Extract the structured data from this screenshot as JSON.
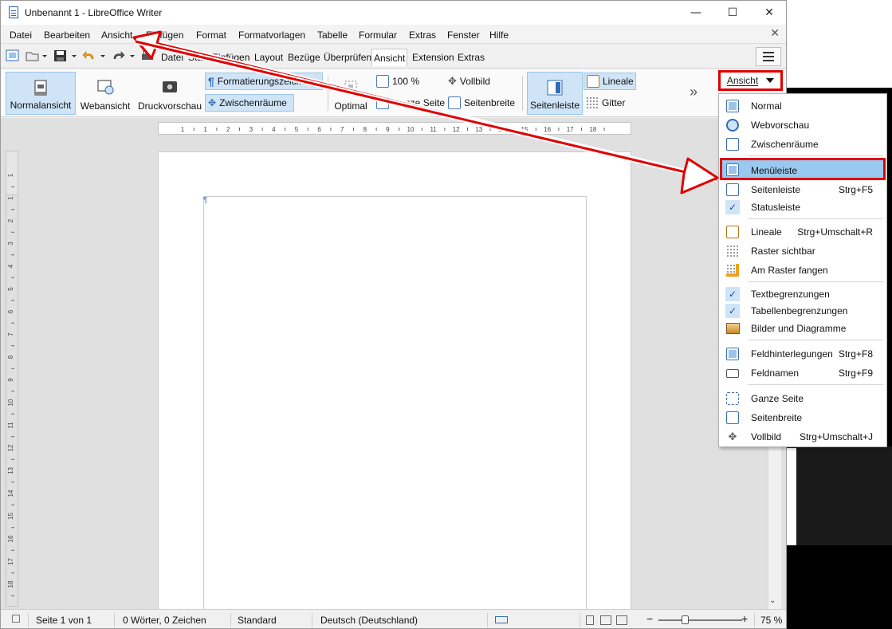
{
  "window": {
    "title": "Unbenannt 1 - LibreOffice Writer",
    "minimize": "—",
    "maximize": "☐",
    "close": "✕"
  },
  "menubar": {
    "items": [
      "Datei",
      "Bearbeiten",
      "Ansicht",
      "Einfügen",
      "Format",
      "Formatvorlagen",
      "Tabelle",
      "Formular",
      "Extras",
      "Fenster",
      "Hilfe"
    ],
    "close": "✕"
  },
  "toolbar": {
    "tabs": [
      "Datei",
      "Start",
      "Einfügen",
      "Layout",
      "Bezüge",
      "Überprüfen",
      "Ansicht",
      "Extension",
      "Extras"
    ],
    "active_tab": "Ansicht"
  },
  "ribbon": {
    "normalansicht": "Normalansicht",
    "webansicht": "Webansicht",
    "druckvorschau": "Druckvorschau",
    "formatierungszeichen": "Formatierungszeichen",
    "zwischenraeume": "Zwischenräume",
    "optimal": "Optimal",
    "zoom100": "100 %",
    "ganze_seite": "Ganze Seite",
    "vollbild": "Vollbild",
    "seitenbreite": "Seitenbreite",
    "seitenleiste": "Seitenleiste",
    "lineale": "Lineale",
    "gitter": "Gitter",
    "more": "»"
  },
  "ansicht_dropdown": {
    "label": "Ansicht"
  },
  "ruler": {
    "h_ticks": [
      "1",
      "1",
      "2",
      "3",
      "4",
      "5",
      "6",
      "7",
      "8",
      "9",
      "10",
      "11",
      "12",
      "13",
      "14",
      "15",
      "16",
      "17",
      "18"
    ],
    "v_ticks": [
      "1",
      "1",
      "2",
      "3",
      "4",
      "5",
      "6",
      "7",
      "8",
      "9",
      "10",
      "11",
      "12",
      "13",
      "14",
      "15",
      "16",
      "17",
      "18"
    ]
  },
  "document": {
    "pilcrow": "¶"
  },
  "statusbar": {
    "page": "Seite 1 von 1",
    "words": "0 Wörter, 0 Zeichen",
    "style": "Standard",
    "language": "Deutsch (Deutschland)",
    "zoom_minus": "−",
    "zoom_plus": "+",
    "zoom": "75 %"
  },
  "dropdown_menu": {
    "items": [
      {
        "label": "Normal",
        "shortcut": "",
        "icon": "normal-view-icon",
        "checked": false
      },
      {
        "label": "Webvorschau",
        "shortcut": "",
        "icon": "globe-icon",
        "checked": false
      },
      {
        "label": "Zwischenräume",
        "shortcut": "",
        "icon": "whitespace-icon",
        "checked": false
      },
      {
        "label": "Menüleiste",
        "shortcut": "",
        "icon": "menubar-icon",
        "checked": false,
        "highlighted": true
      },
      {
        "label": "Seitenleiste",
        "shortcut": "Strg+F5",
        "icon": "sidebar-icon",
        "checked": false
      },
      {
        "label": "Statusleiste",
        "shortcut": "",
        "icon": "check-icon",
        "checked": true
      },
      {
        "label": "Lineale",
        "shortcut": "Strg+Umschalt+R",
        "icon": "ruler-icon",
        "checked": false
      },
      {
        "label": "Raster sichtbar",
        "shortcut": "",
        "icon": "grid-icon",
        "checked": false
      },
      {
        "label": "Am Raster fangen",
        "shortcut": "",
        "icon": "snap-grid-icon",
        "checked": false
      },
      {
        "label": "Textbegrenzungen",
        "shortcut": "",
        "icon": "check-icon",
        "checked": true
      },
      {
        "label": "Tabellenbegrenzungen",
        "shortcut": "",
        "icon": "check-icon",
        "checked": true
      },
      {
        "label": "Bilder und Diagramme",
        "shortcut": "",
        "icon": "image-icon",
        "checked": false
      },
      {
        "label": "Feldhinterlegungen",
        "shortcut": "Strg+F8",
        "icon": "field-shading-icon",
        "checked": false
      },
      {
        "label": "Feldnamen",
        "shortcut": "Strg+F9",
        "icon": "field-names-icon",
        "checked": false
      },
      {
        "label": "Ganze Seite",
        "shortcut": "",
        "icon": "whole-page-icon",
        "checked": false
      },
      {
        "label": "Seitenbreite",
        "shortcut": "",
        "icon": "page-width-icon",
        "checked": false
      },
      {
        "label": "Vollbild",
        "shortcut": "Strg+Umschalt+J",
        "icon": "fullscreen-icon",
        "checked": false
      }
    ]
  },
  "colors": {
    "annotation_red": "#e00000",
    "highlight": "#99c9ef",
    "accent": "#2f6db6"
  }
}
